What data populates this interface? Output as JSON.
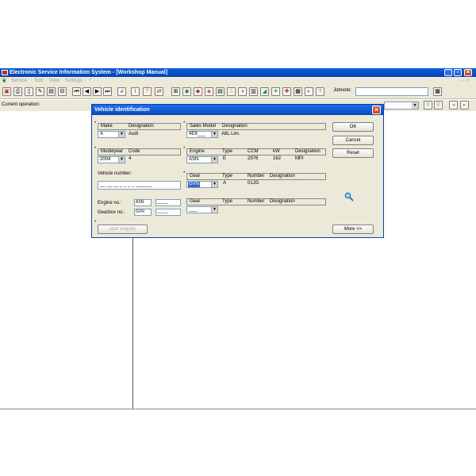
{
  "window": {
    "title": "Electronic Service Information System - [Workshop Manual]"
  },
  "menu": [
    "Service",
    "Edit",
    "View",
    "Settings",
    "?"
  ],
  "toolbar": {
    "jobnote_label": "Jobnote:"
  },
  "operation": {
    "label": "Current operation:"
  },
  "dialog": {
    "title": "Vehicle identification",
    "make": {
      "header_make": "Make",
      "header_designation": "Designation",
      "value": "A",
      "designation": "Audi"
    },
    "sales_model": {
      "header_model": "Sales Model",
      "header_designation": "Designation",
      "value": "4E8___",
      "designation": "A8L Lim."
    },
    "modelyear": {
      "header_year": "Modelyear",
      "header_code": "Code",
      "value": "2004",
      "code": "4"
    },
    "engine": {
      "header_engine": "Engine",
      "header_type": "Type",
      "header_ccm": "CCM",
      "header_kw": "kW",
      "header_designation": "Designation",
      "value": "ASN",
      "type": "E",
      "ccm": "2976",
      "kw": "162",
      "designation": "MPI"
    },
    "vehicle_number": {
      "label": "Vehicle number:",
      "value": "__ __ __ _ _ _ _ ______"
    },
    "gear1": {
      "header_gear": "Gear",
      "header_type": "Type",
      "header_number": "Number",
      "header_designation": "Designation",
      "value": "GVN",
      "type": "A",
      "number": "01JG"
    },
    "gear2": {
      "header_gear": "Gear",
      "header_type": "Type",
      "header_number": "Number",
      "header_designation": "Designation",
      "value": "___"
    },
    "engine_no": {
      "label": "Engine no.:",
      "code": "ASN",
      "value": "_____"
    },
    "gearbox_no": {
      "label": "Gearbox no.:",
      "code": "GVN",
      "value": "_____"
    },
    "buttons": {
      "ok": "OK",
      "cancel": "Cancel",
      "reset": "Reset",
      "more": "More >>",
      "start": "start enquiry"
    }
  }
}
